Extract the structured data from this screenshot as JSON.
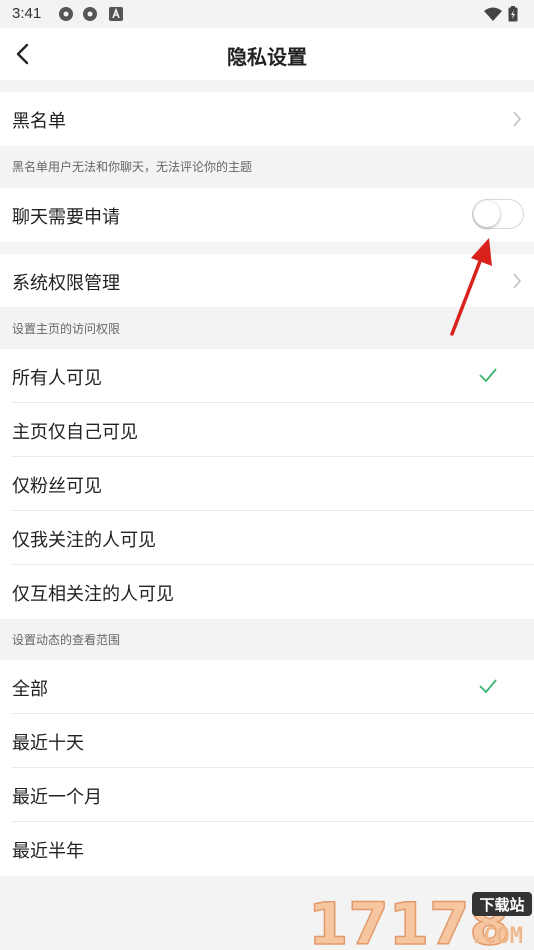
{
  "status_bar": {
    "time": "3:41"
  },
  "header": {
    "title": "隐私设置"
  },
  "blacklist": {
    "label": "黑名单",
    "note": "黑名单用户无法和你聊天，无法评论你的主题"
  },
  "chat_request": {
    "label": "聊天需要申请",
    "toggle_on": false
  },
  "permissions": {
    "label": "系统权限管理"
  },
  "homepage_access": {
    "section_title": "设置主页的访问权限",
    "options": [
      {
        "label": "所有人可见",
        "selected": true
      },
      {
        "label": "主页仅自己可见",
        "selected": false
      },
      {
        "label": "仅粉丝可见",
        "selected": false
      },
      {
        "label": "仅我关注的人可见",
        "selected": false
      },
      {
        "label": "仅互相关注的人可见",
        "selected": false
      }
    ]
  },
  "moments_range": {
    "section_title": "设置动态的查看范围",
    "options": [
      {
        "label": "全部",
        "selected": true
      },
      {
        "label": "最近十天",
        "selected": false
      },
      {
        "label": "最近一个月",
        "selected": false
      },
      {
        "label": "最近半年",
        "selected": false
      }
    ]
  },
  "watermark": {
    "number": "17178",
    "tag": "下载站",
    "domain": ".COM"
  },
  "colors": {
    "accent_check": "#3cb371",
    "annotation_arrow": "#d9221c"
  }
}
